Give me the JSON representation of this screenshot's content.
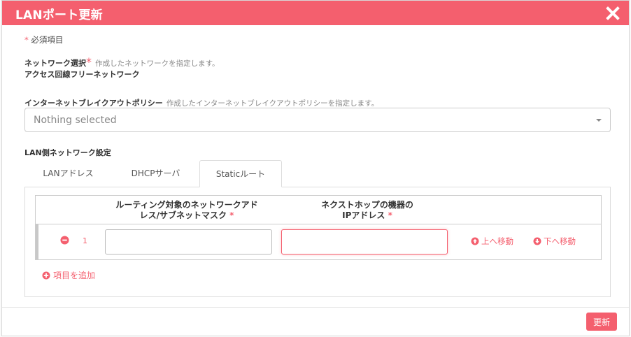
{
  "dialog": {
    "title": "LANポート更新",
    "close_icon": "close-icon"
  },
  "required_note": {
    "star": "*",
    "text": "必須項目"
  },
  "network": {
    "label": "ネットワーク選択",
    "star": "*",
    "hint": "作成したネットワークを指定します。",
    "value": "アクセス回線フリーネットワーク"
  },
  "breakout": {
    "label": "インターネットブレイクアウトポリシー",
    "hint": "作成したインターネットブレイクアウトポリシーを指定します。",
    "select_placeholder": "Nothing selected"
  },
  "lan_section": {
    "title": "LAN側ネットワーク設定",
    "tabs": [
      {
        "label": "LANアドレス",
        "active": false
      },
      {
        "label": "DHCPサーバ",
        "active": false
      },
      {
        "label": "Staticルート",
        "active": true
      }
    ]
  },
  "static_table": {
    "columns": [
      {
        "line1": "ルーティング対象のネットワークアド",
        "line2": "レス/サブネットマスク",
        "star": "*"
      },
      {
        "line1": "ネクストホップの機器の",
        "line2": "IPアドレス",
        "star": "*"
      }
    ],
    "rows": [
      {
        "index": "1",
        "network_value": "",
        "nexthop_value": "",
        "move_up": "上へ移動",
        "move_down": "下へ移動"
      }
    ],
    "add_label": "項目を追加"
  },
  "footer": {
    "update_label": "更新"
  },
  "colors": {
    "accent": "#f45f6e",
    "border": "#cccccc"
  }
}
